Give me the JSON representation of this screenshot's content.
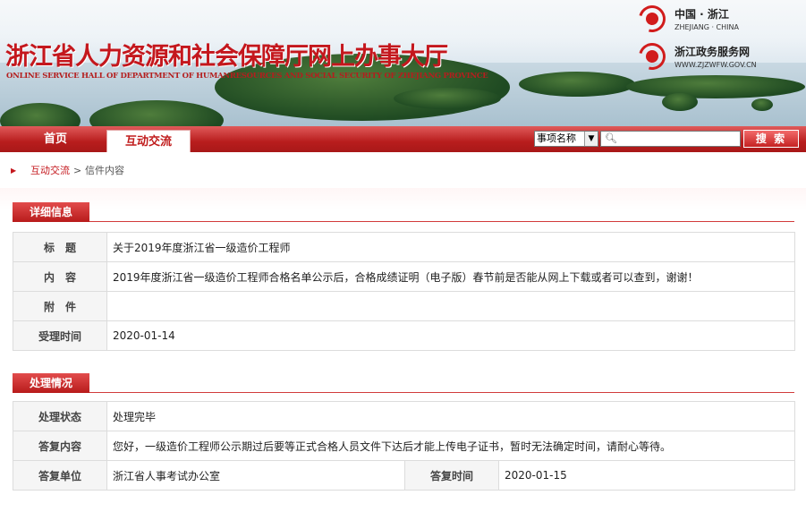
{
  "header": {
    "title": "浙江省人力资源和社会保障厅网上办事大厅",
    "subtitle": "ONLINE SERVICE HALL OF DEPARTMENT OF HUMANRESOURCES AND SOCIAL SECURITY OF ZHEJIANG PROVINCE",
    "logo1_title": "中国 · 浙江",
    "logo1_sub": "ZHEJIANG · CHINA",
    "logo2_title": "浙江政务服务网",
    "logo2_sub": "WWW.ZJZWFW.GOV.CN",
    "accent_color": "#c4171d"
  },
  "nav": {
    "home": "首页",
    "active_tab": "互动交流",
    "search_select": "事项名称",
    "search_placeholder": "",
    "search_button": "搜 索"
  },
  "breadcrumb": {
    "item1": "互动交流",
    "separator": ">",
    "item2": "信件内容"
  },
  "detail": {
    "heading": "详细信息",
    "rows": [
      {
        "label": "标　题",
        "value": "关于2019年度浙江省一级造价工程师"
      },
      {
        "label": "内　容",
        "value": "2019年度浙江省一级造价工程师合格名单公示后，合格成绩证明（电子版）春节前是否能从网上下载或者可以查到，谢谢！"
      },
      {
        "label": "附　件",
        "value": ""
      },
      {
        "label": "受理时间",
        "value": "2020-01-14"
      }
    ]
  },
  "process": {
    "heading": "处理情况",
    "status_label": "处理状态",
    "status_value": "处理完毕",
    "reply_label": "答复内容",
    "reply_value": "您好，一级造价工程师公示期过后要等正式合格人员文件下达后才能上传电子证书，暂时无法确定时间，请耐心等待。",
    "unit_label": "答复单位",
    "unit_value": "浙江省人事考试办公室",
    "time_label": "答复时间",
    "time_value": "2020-01-15"
  }
}
